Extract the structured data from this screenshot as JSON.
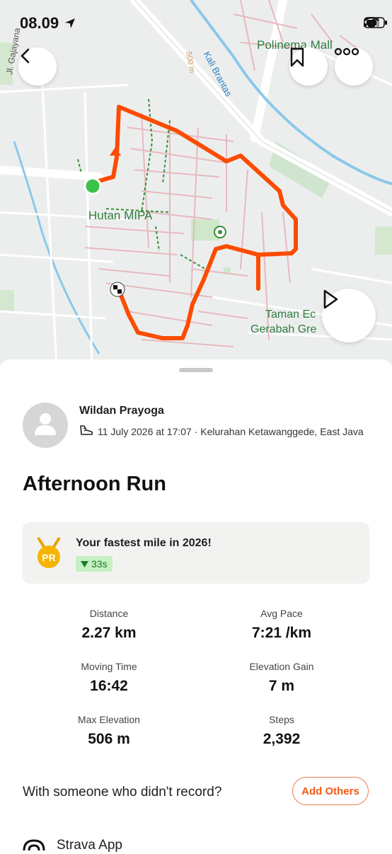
{
  "status_bar": {
    "time": "08.09"
  },
  "map": {
    "labels": {
      "place1": "Polinema Mall",
      "place2": "Hutan MIPA",
      "place3": "Taman Ec",
      "place4": "Gerabah Gre",
      "river": "Kali Brantas",
      "contour": "500 m",
      "street": "Jl. Gajayana"
    },
    "route_color": "#fc4c02"
  },
  "athlete": {
    "name": "Wildan Prayoga",
    "meta": "11 July 2026 at 17:07 · Kelurahan Ketawanggede, East Java"
  },
  "activity": {
    "title": "Afternoon Run"
  },
  "pr": {
    "icon_text": "PR",
    "title": "Your fastest mile in 2026!",
    "badge": "33s"
  },
  "stats": [
    {
      "label": "Distance",
      "value": "2.27 km"
    },
    {
      "label": "Avg Pace",
      "value": "7:21 /km"
    },
    {
      "label": "Moving Time",
      "value": "16:42"
    },
    {
      "label": "Elevation Gain",
      "value": "7 m"
    },
    {
      "label": "Max Elevation",
      "value": "506 m"
    },
    {
      "label": "Steps",
      "value": "2,392"
    }
  ],
  "others": {
    "prompt": "With someone who didn't record?",
    "button": "Add Others"
  },
  "device": {
    "label": "Strava App"
  },
  "icons": [
    "back-icon",
    "bookmark-icon",
    "more-icon",
    "play-icon",
    "shoe-icon",
    "avatar-icon",
    "medal-icon",
    "signal-icon",
    "wifi-icon",
    "battery-icon",
    "location-arrow-icon",
    "broadcast-icon"
  ]
}
